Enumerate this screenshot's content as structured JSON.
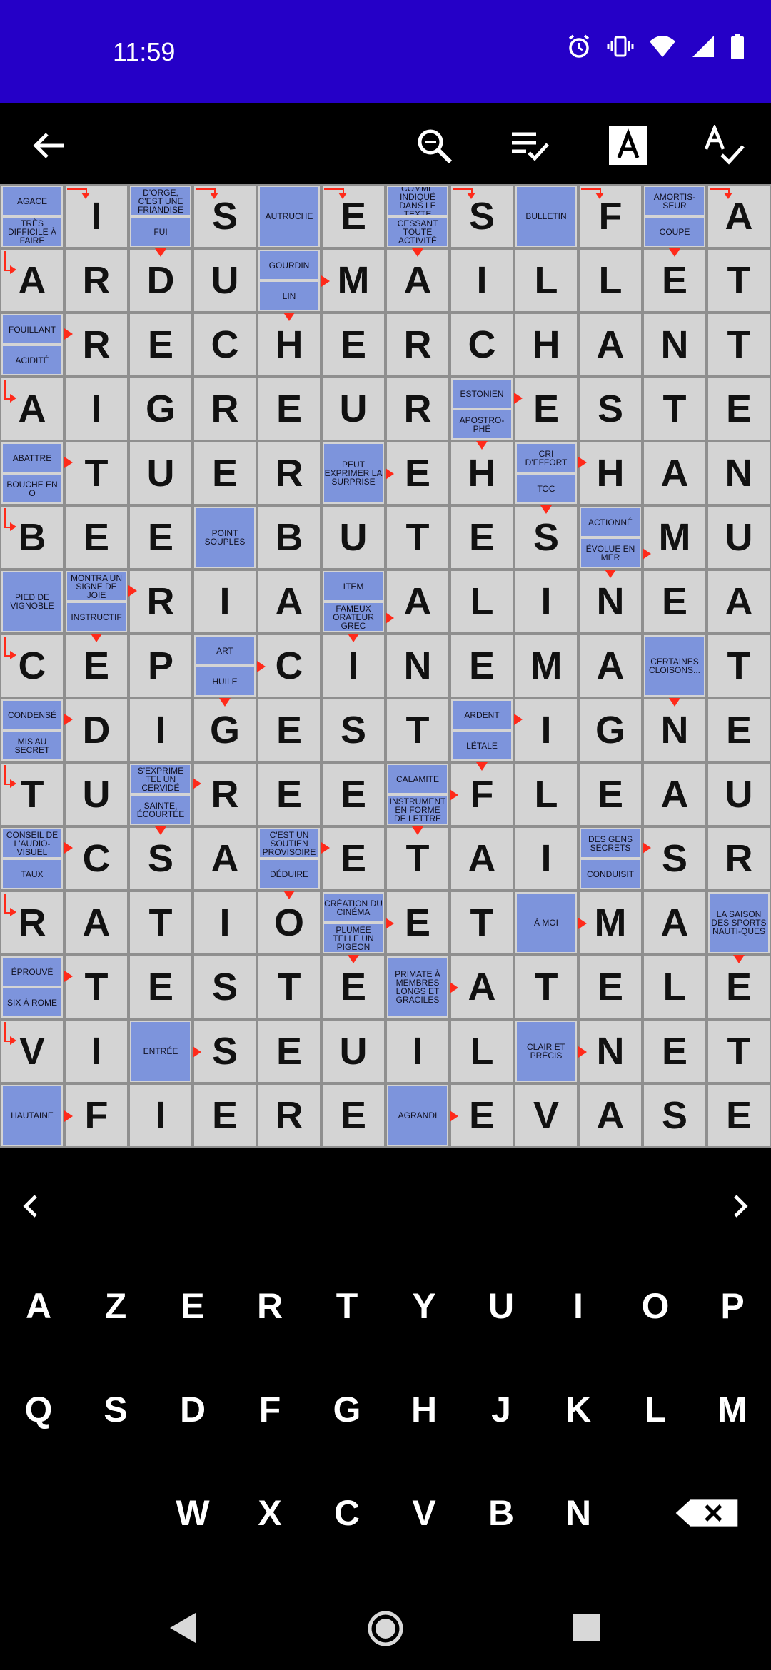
{
  "status": {
    "time": "11:59",
    "icons": [
      "alarm-icon",
      "vibrate-icon",
      "wifi-icon",
      "signal-icon",
      "battery-icon"
    ]
  },
  "toolbar": {
    "icons": [
      "back-arrow-icon",
      "zoom-icon",
      "checklist-icon",
      "letter-a-icon",
      "spellcheck-icon"
    ]
  },
  "colors": {
    "clue_bg": "#7d94dc",
    "cell_bg": "#d4d4d4",
    "arrow": "#ff2a1a",
    "status_bar": "#2500c7"
  },
  "grid": {
    "rows": [
      [
        [
          "AGACE",
          "TRÈS DIFFICILE À FAIRE"
        ],
        "I",
        [
          "D'ORGE, C'EST UNE FRIANDISE",
          "FUI"
        ],
        "S",
        [
          "AUTRUCHE"
        ],
        "E",
        [
          "COMME INDIQUÉ DANS LE TEXTE",
          "CESSANT TOUTE ACTIVITÉ"
        ],
        "S",
        [
          "BULLETIN"
        ],
        "F",
        [
          "AMORTIS-SEUR",
          "COUPE"
        ],
        "A"
      ],
      [
        "A",
        "R",
        "D",
        "U",
        [
          "GOURDIN",
          "LIN"
        ],
        "M",
        "A",
        "I",
        "L",
        "L",
        "E",
        "T"
      ],
      [
        [
          "FOUILLANT",
          "ACIDITÉ"
        ],
        "R",
        "E",
        "C",
        "H",
        "E",
        "R",
        "C",
        "H",
        "A",
        "N",
        "T"
      ],
      [
        "A",
        "I",
        "G",
        "R",
        "E",
        "U",
        "R",
        [
          "ESTONIEN",
          "APOSTRO-PHÉ"
        ],
        "E",
        "S",
        "T",
        "E"
      ],
      [
        [
          "ABATTRE",
          "BOUCHE EN O"
        ],
        "T",
        "U",
        "E",
        "R",
        [
          "PEUT EXPRIMER LA SURPRISE"
        ],
        "E",
        "H",
        [
          "CRI D'EFFORT",
          "TOC"
        ],
        "H",
        "A",
        "N"
      ],
      [
        "B",
        "E",
        "E",
        [
          "POINT SOUPLES"
        ],
        "B",
        "U",
        "T",
        "E",
        "S",
        [
          "ACTIONNÉ",
          "ÉVOLUE EN MER"
        ],
        "M",
        "U"
      ],
      [
        [
          "PIED DE VIGNOBLE"
        ],
        [
          "MONTRA UN SIGNE DE JOIE",
          "INSTRUCTIF"
        ],
        "R",
        "I",
        "A",
        [
          "ITEM",
          "FAMEUX ORATEUR GREC"
        ],
        "A",
        "L",
        "I",
        "N",
        "E",
        "A"
      ],
      [
        "C",
        "E",
        "P",
        [
          "ART",
          "HUILE"
        ],
        "C",
        "I",
        "N",
        "E",
        "M",
        "A",
        [
          "CERTAINES CLOISONS..."
        ],
        "T"
      ],
      [
        [
          "CONDENSÉ",
          "MIS AU SECRET"
        ],
        "D",
        "I",
        "G",
        "E",
        "S",
        "T",
        [
          "ARDENT",
          "LÉTALE"
        ],
        "I",
        "G",
        "N",
        "E"
      ],
      [
        "T",
        "U",
        [
          "S'EXPRIME TEL UN CERVIDÉ",
          "SAINTE, ÉCOURTÉE"
        ],
        "R",
        "E",
        "E",
        [
          "CALAMITE",
          "INSTRUMENT EN FORME DE LETTRE"
        ],
        "F",
        "L",
        "E",
        "A",
        "U"
      ],
      [
        [
          "CONSEIL DE L'AUDIO-VISUEL",
          "TAUX"
        ],
        "C",
        "S",
        "A",
        [
          "C'EST UN SOUTIEN PROVISOIRE",
          "DÉDUIRE"
        ],
        "E",
        "T",
        "A",
        "I",
        [
          "DES GENS SECRETS",
          "CONDUISIT"
        ],
        "S",
        "R"
      ],
      [
        "R",
        "A",
        "T",
        "I",
        "O",
        [
          "CRÉATION DU CINÉMA",
          "PLUMÉE TELLE UN PIGEON"
        ],
        "E",
        "T",
        [
          "À MOI"
        ],
        "M",
        "A",
        [
          "LA SAISON DES SPORTS NAUTI-QUES"
        ]
      ],
      [
        [
          "ÉPROUVÉ",
          "SIX À ROME"
        ],
        "T",
        "E",
        "S",
        "T",
        "E",
        [
          "PRIMATE À MEMBRES LONGS ET GRACILES"
        ],
        "A",
        "T",
        "E",
        "L",
        "E"
      ],
      [
        "V",
        "I",
        [
          "ENTRÉE"
        ],
        "S",
        "E",
        "U",
        "I",
        "L",
        [
          "CLAIR ET PRÉCIS"
        ],
        "N",
        "E",
        "T"
      ],
      [
        [
          "HAUTAINE"
        ],
        "F",
        "I",
        "E",
        "R",
        "E",
        [
          "AGRANDI"
        ],
        "E",
        "V",
        "A",
        "S",
        "E"
      ]
    ]
  },
  "keyboard": {
    "row1": [
      "A",
      "Z",
      "E",
      "R",
      "T",
      "Y",
      "U",
      "I",
      "O",
      "P"
    ],
    "row2": [
      "Q",
      "S",
      "D",
      "F",
      "G",
      "H",
      "J",
      "K",
      "L",
      "M"
    ],
    "row3": [
      "W",
      "X",
      "C",
      "V",
      "B",
      "N"
    ],
    "backspace_icon": "backspace-icon"
  },
  "nav": {
    "prev_icon": "chevron-left-icon",
    "next_icon": "chevron-right-icon"
  },
  "system_nav": [
    "back-triangle-icon",
    "home-circle-icon",
    "recents-square-icon"
  ]
}
